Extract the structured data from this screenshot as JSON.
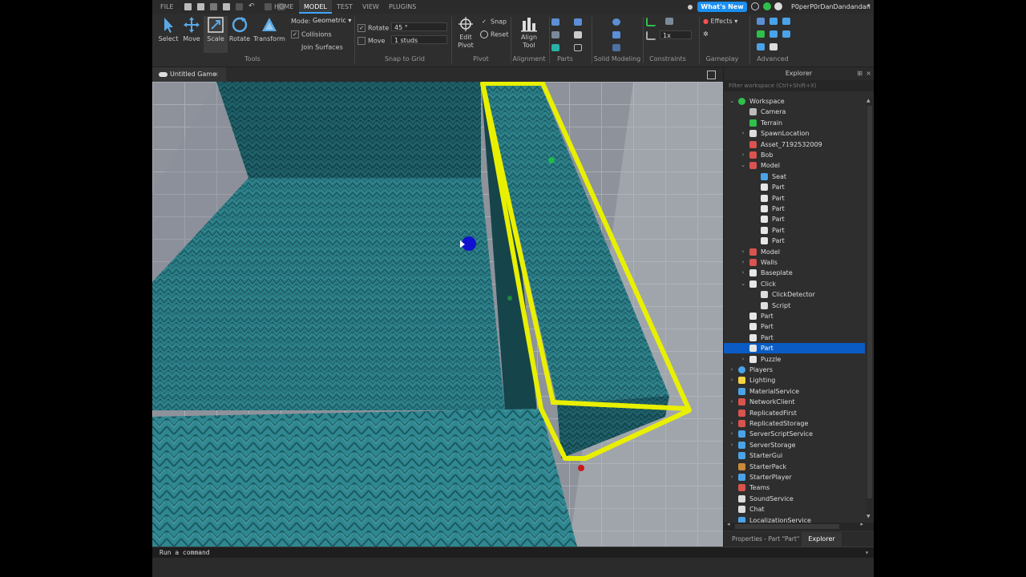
{
  "menubar": {
    "file": "FILE",
    "tabs": [
      "HOME",
      "MODEL",
      "TEST",
      "VIEW",
      "PLUGINS"
    ],
    "active_tab": "MODEL",
    "whats_new": "What's New",
    "username": "P0perP0rDanDandandan"
  },
  "ribbon": {
    "tools": [
      "Select",
      "Move",
      "Scale",
      "Rotate",
      "Transform"
    ],
    "active_tool": "Scale",
    "mode_label": "Mode:",
    "mode_value": "Geometric",
    "collisions": "Collisions",
    "join_surfaces": "Join Surfaces",
    "rotate_label": "Rotate",
    "rotate_value": "45 °",
    "move_label": "Move",
    "move_value": "1 studs",
    "edit_pivot": "Edit Pivot",
    "snap": "Snap",
    "reset": "Reset",
    "align_tool": "Align Tool",
    "effects": "Effects",
    "constraint_scale": "1x",
    "groups": [
      "Tools",
      "Snap to Grid",
      "Pivot",
      "Alignment",
      "Parts",
      "Solid Modeling",
      "Constraints",
      "Gameplay",
      "Advanced"
    ]
  },
  "viewport": {
    "tab_title": "Untitled Game"
  },
  "explorer": {
    "title": "Explorer",
    "filter_placeholder": "Filter workspace (Ctrl+Shift+X)",
    "items": [
      {
        "label": "Workspace",
        "depth": 0,
        "arrow": "open",
        "icon": "globe"
      },
      {
        "label": "Camera",
        "depth": 1,
        "arrow": "",
        "icon": "camera"
      },
      {
        "label": "Terrain",
        "depth": 1,
        "arrow": "",
        "icon": "terrain"
      },
      {
        "label": "SpawnLocation",
        "depth": 1,
        "arrow": "closed",
        "icon": "spawn"
      },
      {
        "label": "Asset_7192532009",
        "depth": 1,
        "arrow": "",
        "icon": "model"
      },
      {
        "label": "Bob",
        "depth": 1,
        "arrow": "closed",
        "icon": "model"
      },
      {
        "label": "Model",
        "depth": 1,
        "arrow": "open",
        "icon": "model"
      },
      {
        "label": "Seat",
        "depth": 2,
        "arrow": "",
        "icon": "seat"
      },
      {
        "label": "Part",
        "depth": 2,
        "arrow": "",
        "icon": "part"
      },
      {
        "label": "Part",
        "depth": 2,
        "arrow": "",
        "icon": "part"
      },
      {
        "label": "Part",
        "depth": 2,
        "arrow": "",
        "icon": "part"
      },
      {
        "label": "Part",
        "depth": 2,
        "arrow": "",
        "icon": "part"
      },
      {
        "label": "Part",
        "depth": 2,
        "arrow": "",
        "icon": "part"
      },
      {
        "label": "Part",
        "depth": 2,
        "arrow": "",
        "icon": "part"
      },
      {
        "label": "Model",
        "depth": 1,
        "arrow": "closed",
        "icon": "model"
      },
      {
        "label": "Walls",
        "depth": 1,
        "arrow": "closed",
        "icon": "model"
      },
      {
        "label": "Baseplate",
        "depth": 1,
        "arrow": "closed",
        "icon": "part"
      },
      {
        "label": "Click",
        "depth": 1,
        "arrow": "open",
        "icon": "part"
      },
      {
        "label": "ClickDetector",
        "depth": 2,
        "arrow": "",
        "icon": "detector"
      },
      {
        "label": "Script",
        "depth": 2,
        "arrow": "",
        "icon": "script"
      },
      {
        "label": "Part",
        "depth": 1,
        "arrow": "",
        "icon": "part"
      },
      {
        "label": "Part",
        "depth": 1,
        "arrow": "",
        "icon": "part"
      },
      {
        "label": "Part",
        "depth": 1,
        "arrow": "",
        "icon": "part"
      },
      {
        "label": "Part",
        "depth": 1,
        "arrow": "",
        "icon": "part",
        "selected": true
      },
      {
        "label": "Puzzle",
        "depth": 1,
        "arrow": "closed",
        "icon": "part"
      },
      {
        "label": "Players",
        "depth": 0,
        "arrow": "closed",
        "icon": "players"
      },
      {
        "label": "Lighting",
        "depth": 0,
        "arrow": "closed",
        "icon": "lighting"
      },
      {
        "label": "MaterialService",
        "depth": 0,
        "arrow": "",
        "icon": "material"
      },
      {
        "label": "NetworkClient",
        "depth": 0,
        "arrow": "closed",
        "icon": "network"
      },
      {
        "label": "ReplicatedFirst",
        "depth": 0,
        "arrow": "",
        "icon": "replicated"
      },
      {
        "label": "ReplicatedStorage",
        "depth": 0,
        "arrow": "closed",
        "icon": "replicated"
      },
      {
        "label": "ServerScriptService",
        "depth": 0,
        "arrow": "closed",
        "icon": "server"
      },
      {
        "label": "ServerStorage",
        "depth": 0,
        "arrow": "closed",
        "icon": "server"
      },
      {
        "label": "StarterGui",
        "depth": 0,
        "arrow": "",
        "icon": "gui"
      },
      {
        "label": "StarterPack",
        "depth": 0,
        "arrow": "",
        "icon": "pack"
      },
      {
        "label": "StarterPlayer",
        "depth": 0,
        "arrow": "closed",
        "icon": "player"
      },
      {
        "label": "Teams",
        "depth": 0,
        "arrow": "",
        "icon": "teams"
      },
      {
        "label": "SoundService",
        "depth": 0,
        "arrow": "",
        "icon": "sound"
      },
      {
        "label": "Chat",
        "depth": 0,
        "arrow": "",
        "icon": "chat"
      },
      {
        "label": "LocalizationService",
        "depth": 0,
        "arrow": "",
        "icon": "localization"
      }
    ],
    "bottom_tabs": [
      "Properties - Part \"Part\"",
      "Explorer"
    ]
  },
  "command": {
    "placeholder": "Run a command"
  },
  "colors": {
    "accent": "#3ea6ff",
    "selection": "#e8f000",
    "knit": "#2a7d86",
    "selected_row": "#0b5bc4"
  }
}
